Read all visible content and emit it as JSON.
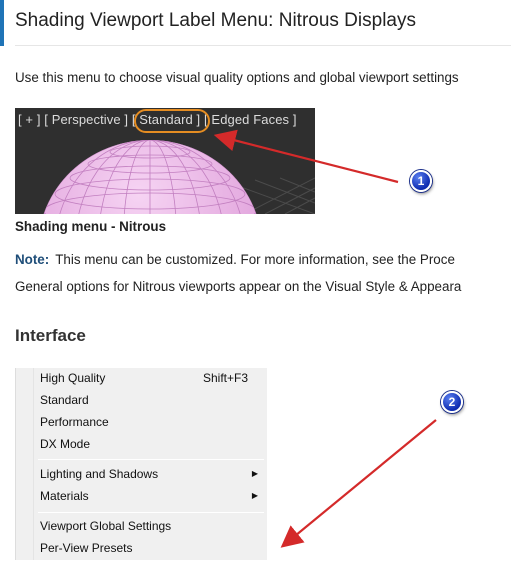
{
  "page": {
    "title": "Shading Viewport Label Menu: Nitrous Displays",
    "intro": "Use this menu to choose visual quality options and global viewport settings"
  },
  "viewport_label": {
    "plus": "[ + ]",
    "perspective": "[ Perspective ]",
    "standard": "[ Standard ]",
    "edged_faces": "[ Edged Faces ]"
  },
  "caption": "Shading menu - Nitrous",
  "note": {
    "label": "Note:",
    "text": "This menu can be customized. For more information, see the Proce"
  },
  "general_text": "General options for Nitrous viewports appear on the Visual Style & Appeara",
  "section_heading": "Interface",
  "menu": {
    "items": [
      {
        "label": "High Quality",
        "shortcut": "Shift+F3"
      },
      {
        "label": "Standard"
      },
      {
        "label": "Performance"
      },
      {
        "label": "DX Mode"
      },
      {
        "label": "Lighting and Shadows",
        "submenu_arrow": "▶"
      },
      {
        "label": "Materials",
        "submenu_arrow": "▶"
      },
      {
        "label": "Viewport Global Settings"
      },
      {
        "label": "Per-View Presets"
      }
    ]
  },
  "callouts": [
    {
      "number": "1"
    },
    {
      "number": "2"
    }
  ],
  "colors": {
    "accent_bar": "#1f74b7",
    "note_label": "#1f4e79",
    "highlight_ring": "#e58d22",
    "arrow": "#d42a2a",
    "badge": "#1a3fd0",
    "sphere": "#eab3e6"
  }
}
